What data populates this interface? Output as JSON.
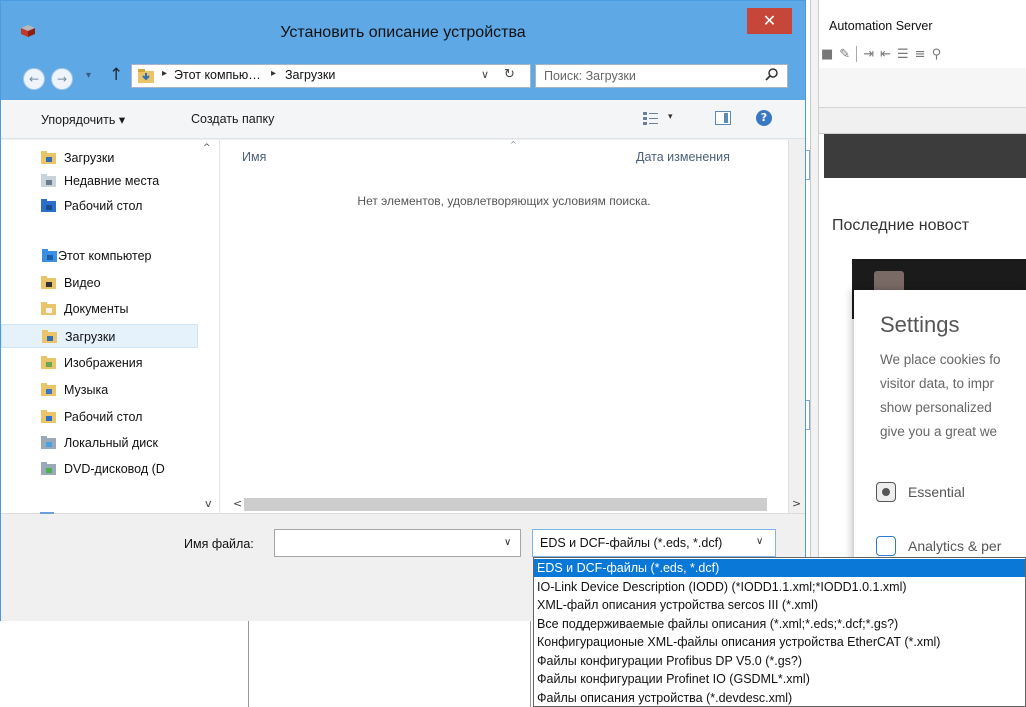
{
  "dialog": {
    "title": "Установить описание устройства",
    "close_glyph": "✕",
    "nav": {
      "back_glyph": "←",
      "forward_glyph": "→",
      "recent_glyph": "▾",
      "up_glyph": "↑",
      "path": [
        "Этот компью…",
        "Загрузки"
      ],
      "path_sep": "▸",
      "dropdown_glyph": "∨",
      "refresh_glyph": "↻"
    },
    "search": {
      "placeholder": "Поиск: Загрузки"
    },
    "toolbar": {
      "organize": "Упорядочить ▾",
      "new_folder": "Создать папку",
      "view_dd_glyph": "▾",
      "help_glyph": "?"
    },
    "nav_pane": {
      "items": [
        {
          "label": "Загрузки",
          "icon": "downloads-folder-icon"
        },
        {
          "label": "Недавние места",
          "icon": "recent-places-icon"
        },
        {
          "label": "Рабочий стол",
          "icon": "desktop-icon"
        },
        {
          "label": "Этот компьютер",
          "icon": "computer-icon"
        },
        {
          "label": "Видео",
          "icon": "videos-folder-icon"
        },
        {
          "label": "Документы",
          "icon": "documents-folder-icon"
        },
        {
          "label": "Загрузки",
          "icon": "downloads-folder-icon"
        },
        {
          "label": "Изображения",
          "icon": "pictures-folder-icon"
        },
        {
          "label": "Музыка",
          "icon": "music-folder-icon"
        },
        {
          "label": "Рабочий стол",
          "icon": "desktop-folder-icon"
        },
        {
          "label": "Локальный диск",
          "icon": "local-disk-icon"
        },
        {
          "label": "DVD-дисковод (D",
          "icon": "dvd-drive-icon"
        }
      ],
      "selected_index": 6,
      "scroll_up_glyph": "^",
      "scroll_down_glyph": "v"
    },
    "list": {
      "col_name": "Имя",
      "col_date": "Дата изменения",
      "sort_glyph": "^",
      "empty_message": "Нет элементов, удовлетворяющих условиям поиска."
    },
    "hscroll": {
      "left_glyph": "<",
      "right_glyph": ">"
    },
    "bottom": {
      "filename_label": "Имя файла:",
      "filename_value": "",
      "filename_dd_glyph": "∨",
      "filter_value": "EDS и DCF-файлы (*.eds, *.dcf)",
      "filter_dd_glyph": "∨"
    },
    "filter_options": [
      "EDS и DCF-файлы (*.eds, *.dcf)",
      "IO-Link Device Description (IODD) (*IODD1.1.xml;*IODD1.0.1.xml)",
      "XML-файл описания устройства sercos III (*.xml)",
      "Все поддерживаемые файлы описания (*.xml;*.eds;*.dcf;*.gs?)",
      "Конфигурационые  XML-файлы описания устройства EtherCAT (*.xml)",
      "Файлы конфигурации Profibus DP V5.0 (*.gs?)",
      "Файлы конфигурации Profinet IO (GSDML*.xml)",
      "Файлы описания устройства (*.devdesc.xml)"
    ],
    "filter_selected_index": 0
  },
  "background_app": {
    "title": "Automation Server",
    "news_heading": "Последние новост",
    "cookie_settings": {
      "title": "Settings",
      "text_lines": [
        "We place cookies fo",
        "visitor data, to impr",
        "show personalized",
        "give you a great we"
      ],
      "options": [
        "Essential",
        "Analytics & per"
      ]
    }
  },
  "colors": {
    "titlebar": "#5ea8e6",
    "close": "#c7463a",
    "selection": "#0a78d7",
    "nav_selected": "#e5f1fb"
  }
}
